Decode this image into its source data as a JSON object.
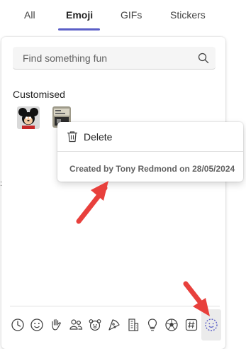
{
  "tabs": [
    {
      "label": "All"
    },
    {
      "label": "Emoji"
    },
    {
      "label": "GIFs"
    },
    {
      "label": "Stickers"
    }
  ],
  "active_tab": "Emoji",
  "accent_color": "#5b5fc7",
  "search": {
    "placeholder": "Find something fun"
  },
  "section": {
    "title": "Customised"
  },
  "custom_emojis": [
    {
      "icon": "mickey-mouse-emoji"
    },
    {
      "icon": "custom-image-emoji"
    }
  ],
  "context_menu": {
    "delete_label": "Delete",
    "created_by": "Created by Tony Redmond on 28/05/2024"
  },
  "categories": [
    {
      "icon": "recent-clock-icon"
    },
    {
      "icon": "smiley-icon"
    },
    {
      "icon": "hand-icon"
    },
    {
      "icon": "people-icon"
    },
    {
      "icon": "animal-icon"
    },
    {
      "icon": "food-icon"
    },
    {
      "icon": "building-icon"
    },
    {
      "icon": "lightbulb-icon"
    },
    {
      "icon": "ball-icon"
    },
    {
      "icon": "hashtag-icon"
    },
    {
      "icon": "custom-dotted-smiley-icon",
      "selected": true
    }
  ],
  "annotation_arrow_color": "#e8403c"
}
